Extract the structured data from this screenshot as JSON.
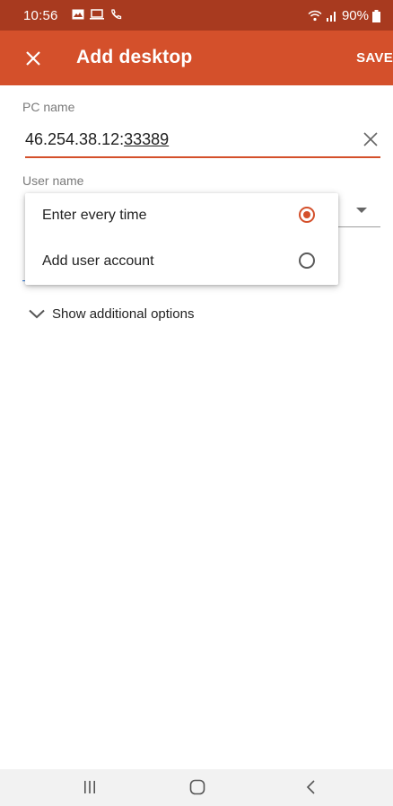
{
  "status_bar": {
    "time": "10:56",
    "battery": "90%",
    "icons": [
      "image-icon",
      "laptop-icon",
      "phone-call-icon",
      "wifi-icon",
      "signal-icon",
      "battery-icon"
    ]
  },
  "app_bar": {
    "title": "Add desktop",
    "save_label": "SAVE",
    "close_icon": "close-icon"
  },
  "form": {
    "pc_name_label": "PC name",
    "pc_name_value_prefix": "46.254.38.12:",
    "pc_name_value_port": "33389",
    "user_name_label": "User name"
  },
  "popup_menu": {
    "items": [
      {
        "label": "Enter every time",
        "selected": true
      },
      {
        "label": "Add user account",
        "selected": false
      }
    ]
  },
  "more_options": {
    "label": "Show additional options"
  },
  "colors": {
    "accent": "#d4502b",
    "status_bar": "#a83a1f"
  }
}
